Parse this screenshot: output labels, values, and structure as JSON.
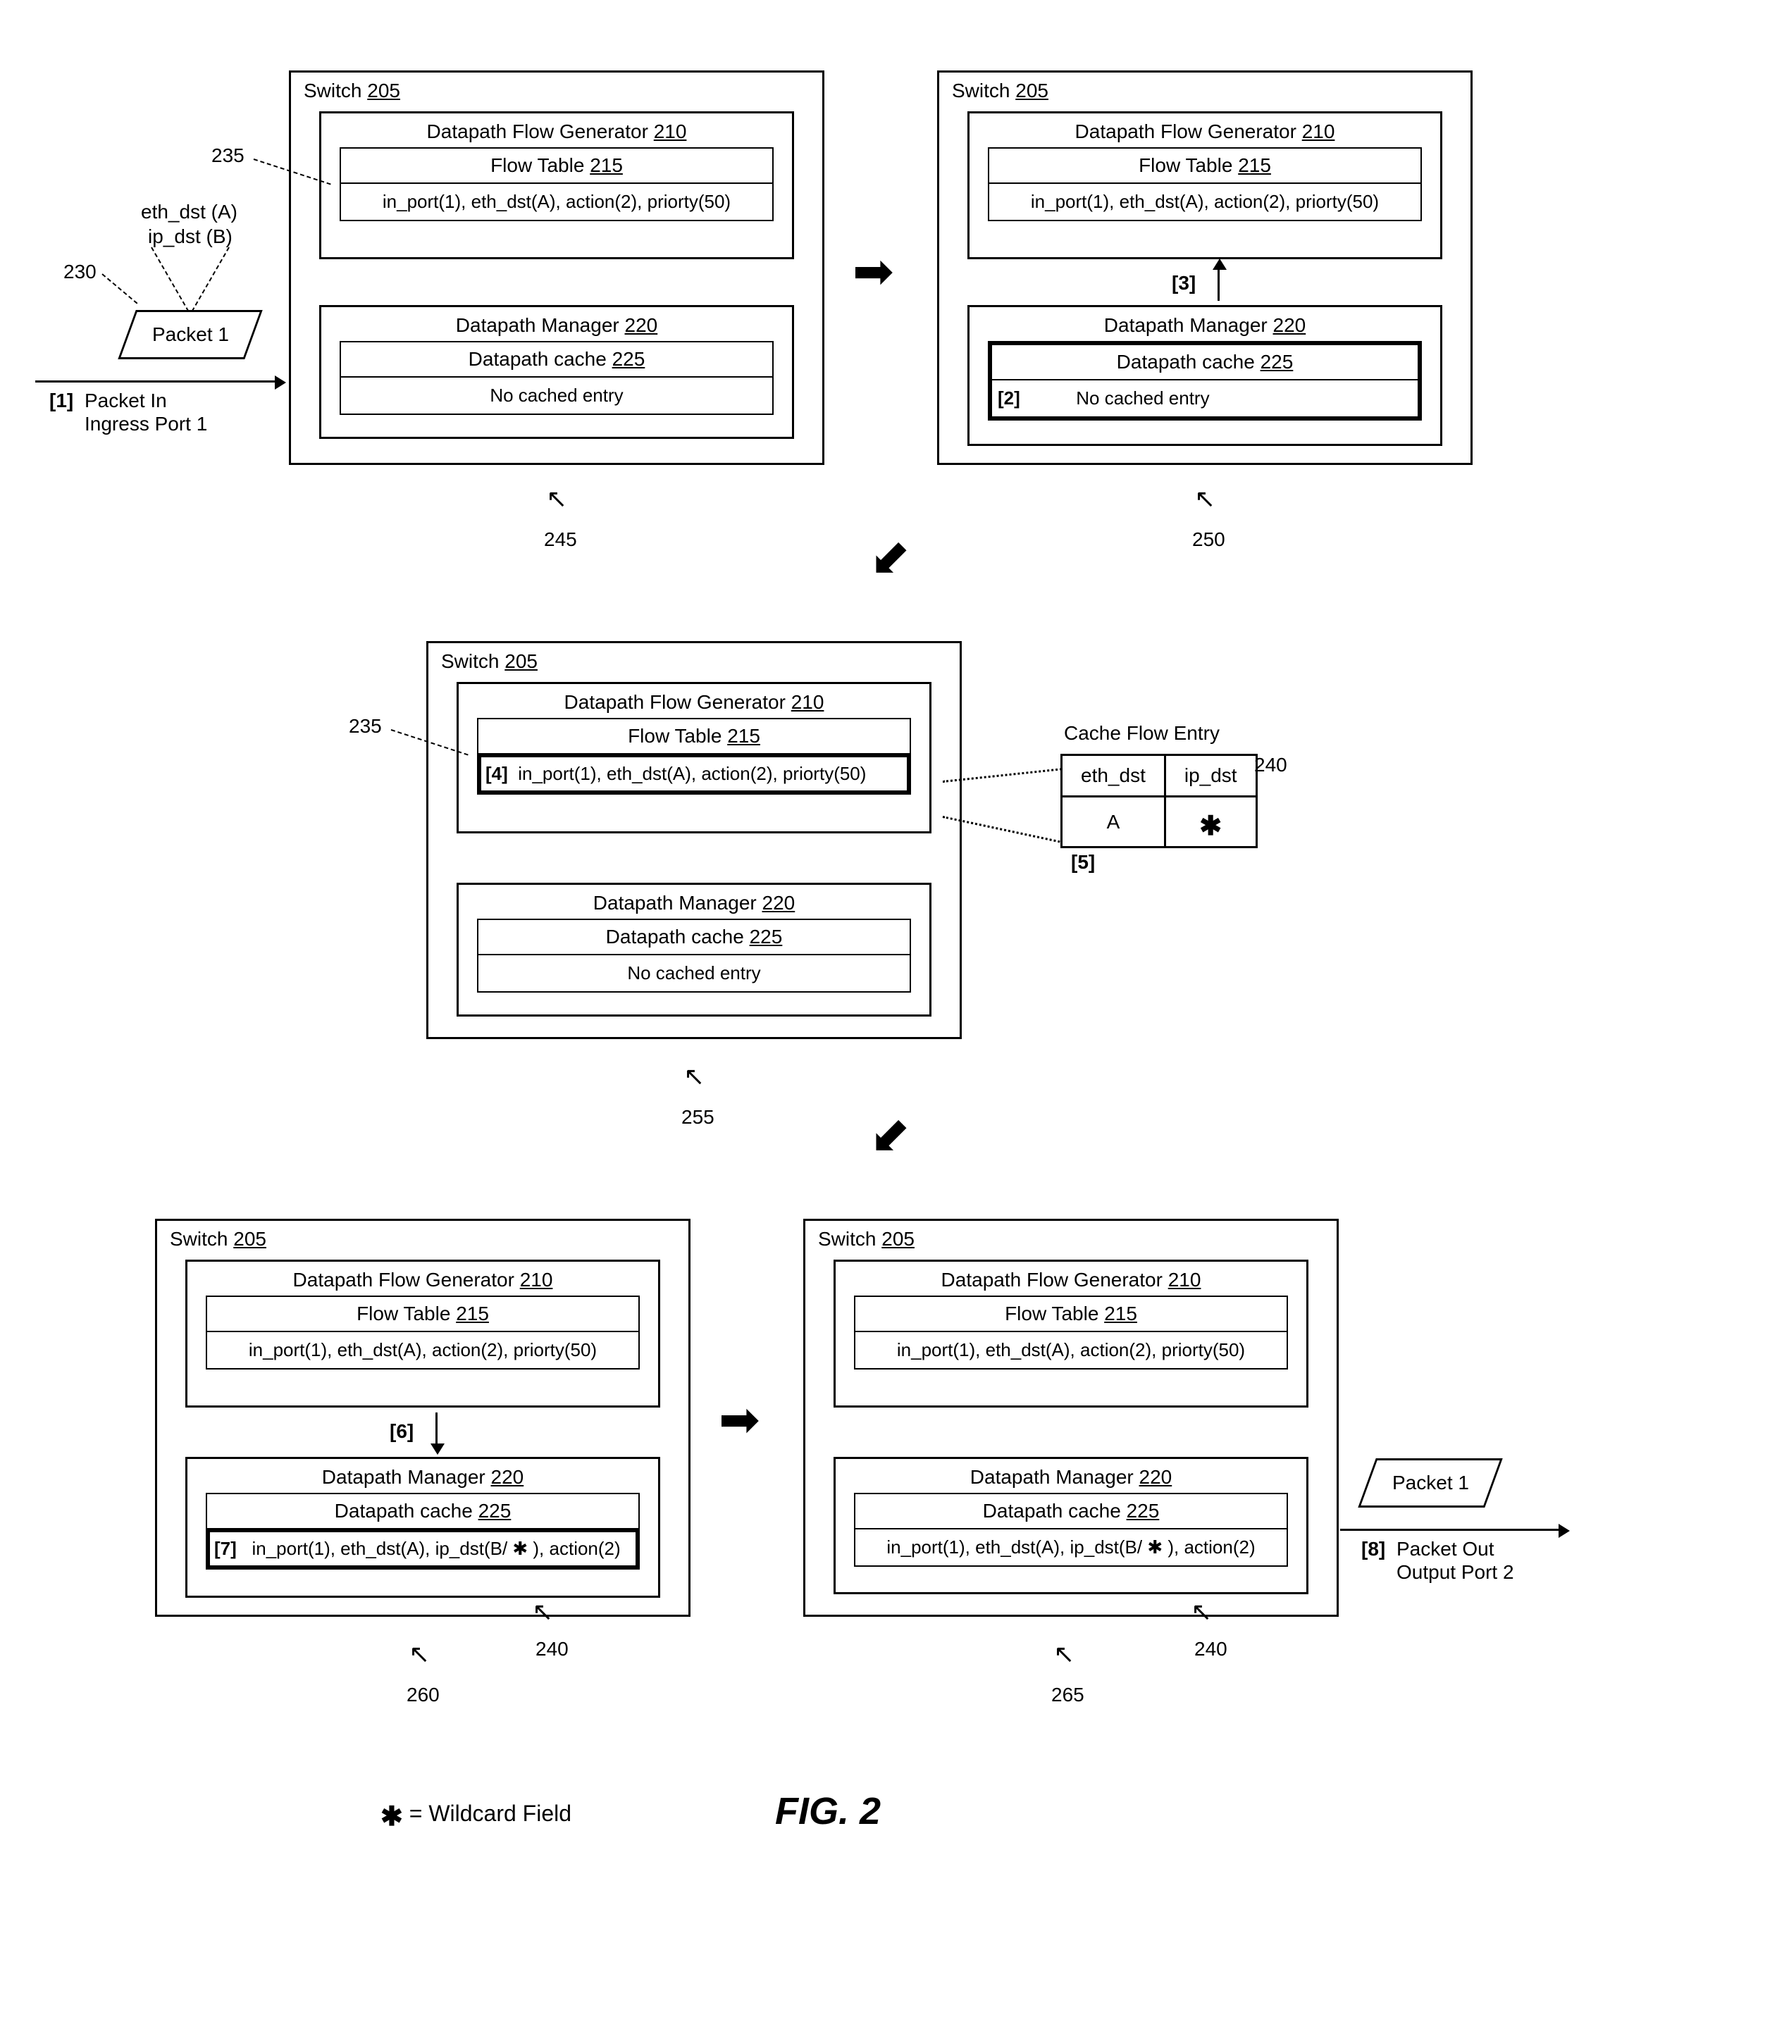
{
  "common": {
    "switch_label_prefix": "Switch ",
    "switch_id": "205",
    "dfg_title_prefix": "Datapath Flow Generator ",
    "dfg_id": "210",
    "flow_table_prefix": "Flow Table ",
    "flow_table_id": "215",
    "flow_rule": "in_port(1), eth_dst(A), action(2), priorty(50)",
    "dpm_title_prefix": "Datapath Manager ",
    "dpm_id": "220",
    "dp_cache_prefix": "Datapath cache   ",
    "dp_cache_id": "225",
    "no_cache": "No cached entry",
    "cached_rule": "in_port(1), eth_dst(A), ip_dst(B/ ✱ ), action(2)"
  },
  "steps": {
    "s1": "[1]",
    "s2": "[2]",
    "s3": "[3]",
    "s4": "[4]",
    "s5": "[5]",
    "s6": "[6]",
    "s7": "[7]",
    "s8": "[8]"
  },
  "packet": {
    "label": "Packet 1",
    "fields_line1": "eth_dst (A)",
    "fields_line2": "ip_dst (B)",
    "in_label_line1": "Packet In",
    "in_label_line2": "Ingress Port 1",
    "out_label_line1": "Packet Out",
    "out_label_line2": "Output Port 2"
  },
  "callouts": {
    "c230": "230",
    "c235": "235",
    "c240": "240",
    "c245": "245",
    "c250": "250",
    "c255": "255",
    "c260": "260",
    "c265": "265",
    "cache_flow_entry": "Cache Flow Entry"
  },
  "cache_table": {
    "h1": "eth_dst",
    "h2": "ip_dst",
    "v1": "A",
    "v2": "✱"
  },
  "fig": "FIG. 2",
  "legend": "= Wildcard Field",
  "legend_star": "✱"
}
